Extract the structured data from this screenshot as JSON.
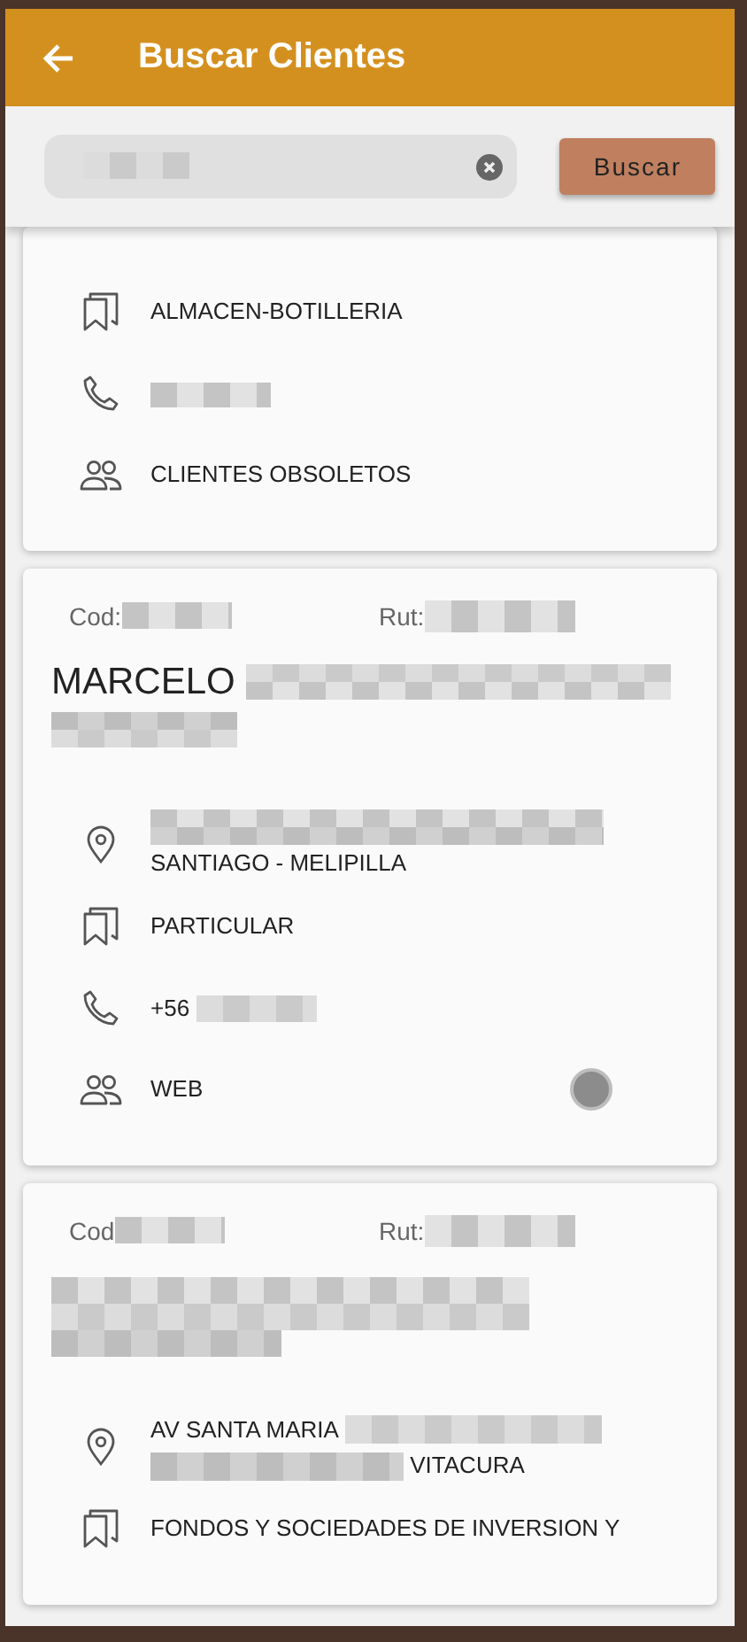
{
  "app_bar": {
    "title": "Buscar Clientes"
  },
  "search": {
    "value_redacted": true,
    "button": "Buscar"
  },
  "clients": [
    {
      "category": "ALMACEN-BOTILLERIA",
      "phone": [
        {
          "kind": "redacted"
        }
      ],
      "group": "CLIENTES OBSOLETOS"
    },
    {
      "code_label": "Cod:",
      "rut_label": "Rut:",
      "name": [
        {
          "kind": "text",
          "text": "MARCELO"
        },
        {
          "kind": "redacted"
        },
        {
          "kind": "redacted"
        }
      ],
      "address": [
        {
          "kind": "redacted"
        },
        {
          "kind": "text",
          "text": "SANTIAGO - MELIPILLA"
        }
      ],
      "category": "PARTICULAR",
      "phone": [
        {
          "kind": "text",
          "text": "+56"
        },
        {
          "kind": "redacted"
        }
      ],
      "group": "WEB"
    },
    {
      "code_label": "Cod",
      "rut_label": "Rut:",
      "name": [
        {
          "kind": "redacted"
        },
        {
          "kind": "redacted"
        },
        {
          "kind": "redacted"
        }
      ],
      "address": [
        {
          "kind": "text",
          "text": "AV SANTA MARIA"
        },
        {
          "kind": "redacted"
        },
        {
          "kind": "redacted"
        },
        {
          "kind": "text",
          "text": "VITACURA"
        }
      ],
      "category": "FONDOS Y SOCIEDADES DE INVERSION Y"
    }
  ]
}
